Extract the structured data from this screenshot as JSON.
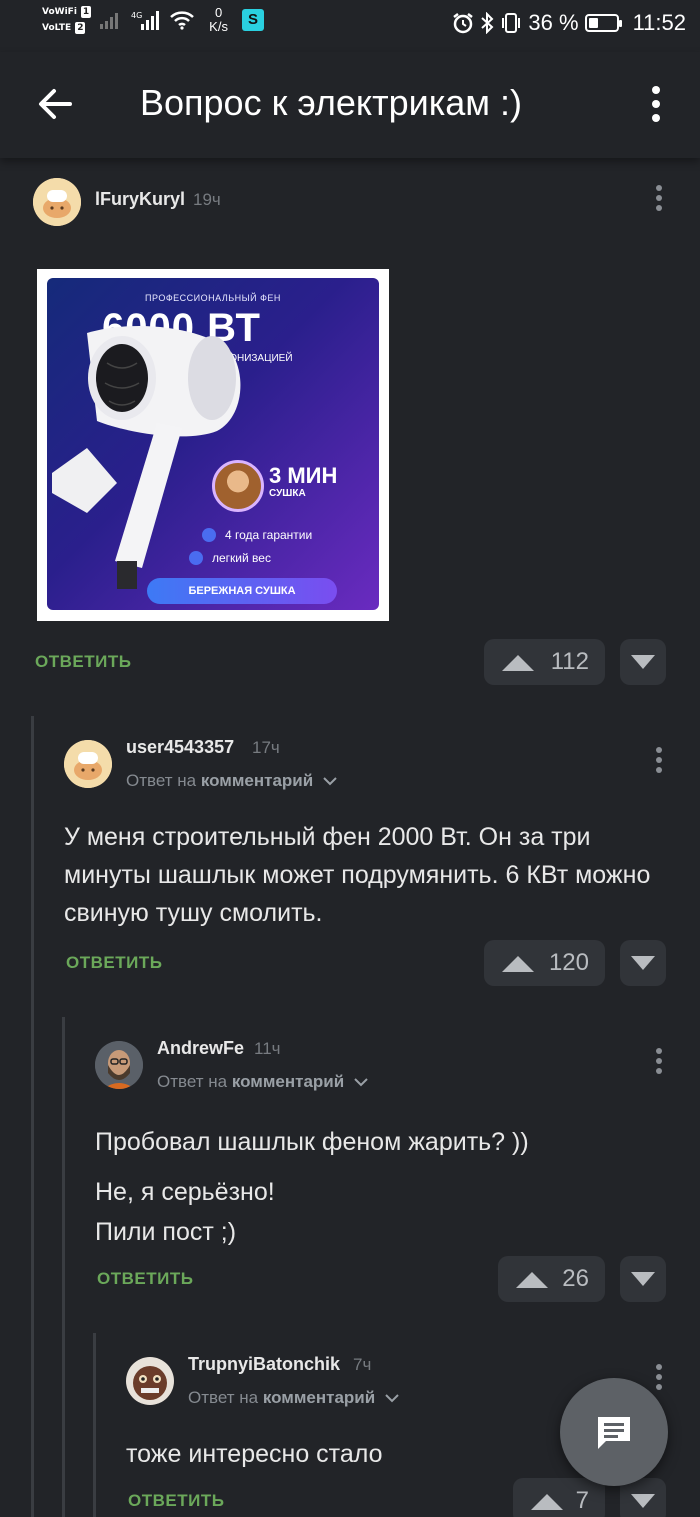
{
  "status_bar": {
    "sim1_tag": "VoWiFi",
    "sim1_num": "1",
    "sim2_tag": "VoLTE",
    "sim2_num": "2",
    "net_speed_value": "0",
    "net_speed_unit": "K/s",
    "battery_percent": "36 %",
    "battery_level": 0.36,
    "time": "11:52"
  },
  "header": {
    "title": "Вопрос к электрикам :)"
  },
  "colors": {
    "background": "#222428",
    "reply_green": "#6ba85a",
    "vote_button": "#313439"
  },
  "comments": [
    {
      "username": "lFuryKuryl",
      "time": "19ч",
      "image": {
        "top_caption": "ПРОФЕССИОНАЛЬНЫЙ ФЕН",
        "power": "6000 ВТ",
        "ionization": "С ИОНИЗАЦИЕЙ",
        "dry_time": "3 МИН",
        "dry_label": "СУШКА",
        "feature1": "4 года гарантии",
        "feature2": "легкий вес",
        "banner": "БЕРЕЖНАЯ СУШКА"
      },
      "reply_label": "ОТВЕТИТЬ",
      "votes": "112"
    },
    {
      "username": "user4543357",
      "time": "17ч",
      "reply_to_prefix": "Ответ на",
      "reply_to_target": "комментарий",
      "text": "У меня строительный фен 2000 Вт. Он за три минуты шашлык может подрумянить. 6 КВт можно свиную тушу смолить.",
      "reply_label": "ОТВЕТИТЬ",
      "votes": "120"
    },
    {
      "username": "AndrewFe",
      "time": "11ч",
      "reply_to_prefix": "Ответ на",
      "reply_to_target": "комментарий",
      "text_line1": "Пробовал шашлык феном жарить? ))",
      "text_line2": "Не, я серьёзно!",
      "text_line3": "Пили пост ;)",
      "reply_label": "ОТВЕТИТЬ",
      "votes": "26"
    },
    {
      "username": "TrupnyiBatonchik",
      "time": "7ч",
      "reply_to_prefix": "Ответ на",
      "reply_to_target": "комментарий",
      "text": "тоже интересно стало",
      "reply_label": "ОТВЕТИТЬ",
      "votes": "7"
    }
  ],
  "icons": {
    "back": "arrow-left-icon",
    "more": "more-vertical-icon",
    "fab": "comment-icon",
    "upvote": "triangle-up-icon",
    "downvote": "triangle-down-icon"
  }
}
